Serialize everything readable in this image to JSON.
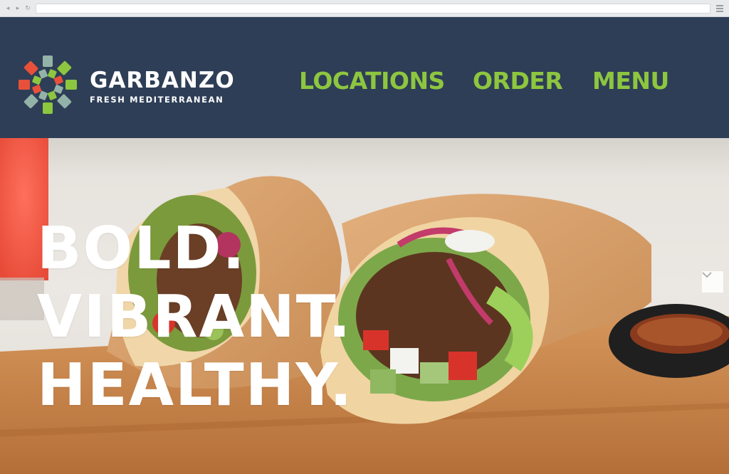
{
  "brand": {
    "name": "GARBANZO",
    "tagline": "FRESH MEDITERRANEAN",
    "colors": {
      "header_bg": "#2e3e57",
      "nav_green": "#8dc63f",
      "logo_red": "#e8503a",
      "logo_green": "#8dc63f",
      "logo_sage": "#93b3a8"
    }
  },
  "nav": {
    "items": [
      {
        "label": "LOCATIONS"
      },
      {
        "label": "ORDER"
      },
      {
        "label": "MENU"
      }
    ]
  },
  "hero": {
    "headline": [
      "BOLD.",
      "VIBRANT.",
      "HEALTHY."
    ],
    "scroll_icon": "chevron-down-icon"
  },
  "browser": {
    "icons": [
      "back-icon",
      "forward-icon",
      "reload-icon",
      "hamburger-menu-icon"
    ]
  }
}
